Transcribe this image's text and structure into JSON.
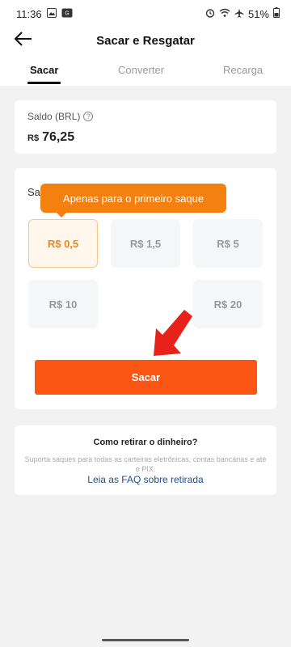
{
  "status_bar": {
    "time": "11:36",
    "battery": "51%",
    "icons": [
      "gallery-icon",
      "data-saver-icon",
      "alarm-icon",
      "wifi-icon",
      "airplane-icon",
      "battery-icon"
    ]
  },
  "header": {
    "title": "Sacar e Resgatar",
    "back_icon": "arrow-left-icon"
  },
  "tabs": [
    {
      "label": "Sacar",
      "active": true
    },
    {
      "label": "Converter",
      "active": false
    },
    {
      "label": "Recarga",
      "active": false
    }
  ],
  "balance": {
    "label": "Saldo (BRL)",
    "help_icon": "question-icon",
    "currency": "R$",
    "amount": "76,25"
  },
  "withdraw": {
    "section_label": "Sa",
    "tooltip": "Apenas para o primeiro saque",
    "options": [
      {
        "label": "R$ 0,5",
        "selected": true
      },
      {
        "label": "R$ 1,5",
        "selected": false
      },
      {
        "label": "R$ 5",
        "selected": false
      },
      {
        "label": "R$ 10",
        "selected": false
      },
      {
        "label": "R$ 20",
        "selected": false
      }
    ],
    "button_label": "Sacar"
  },
  "faq": {
    "title": "Como retirar o dinheiro?",
    "description": "Suporta saques para todas as carteiras eletrônicas, contas bancárias e até o PIX.",
    "link": "Leia as FAQ sobre retirada"
  },
  "colors": {
    "accent": "#fb5614",
    "tooltip": "#f4800f",
    "selected_text": "#f08518",
    "link": "#1d4e92"
  }
}
